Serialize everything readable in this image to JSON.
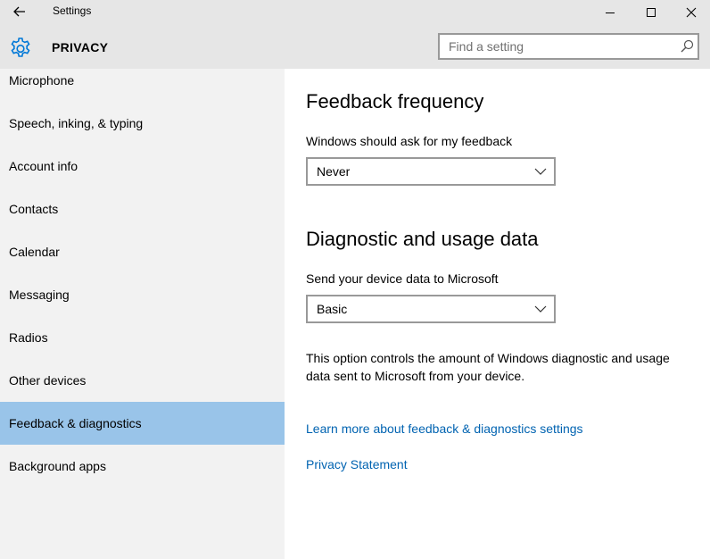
{
  "window": {
    "title": "Settings",
    "controls": [
      "minimize-icon",
      "maximize-icon",
      "close-icon"
    ]
  },
  "header": {
    "title": "PRIVACY",
    "icon": "gear-icon",
    "search": {
      "placeholder": "Find a setting",
      "value": "",
      "icon": "search-icon"
    }
  },
  "sidebar": {
    "items": [
      {
        "label": "Microphone",
        "selected": false
      },
      {
        "label": "Speech, inking, & typing",
        "selected": false
      },
      {
        "label": "Account info",
        "selected": false
      },
      {
        "label": "Contacts",
        "selected": false
      },
      {
        "label": "Calendar",
        "selected": false
      },
      {
        "label": "Messaging",
        "selected": false
      },
      {
        "label": "Radios",
        "selected": false
      },
      {
        "label": "Other devices",
        "selected": false
      },
      {
        "label": "Feedback & diagnostics",
        "selected": true
      },
      {
        "label": "Background apps",
        "selected": false
      }
    ]
  },
  "main": {
    "feedback": {
      "heading": "Feedback frequency",
      "label": "Windows should ask for my feedback",
      "value": "Never"
    },
    "diagnostic": {
      "heading": "Diagnostic and usage data",
      "label": "Send your device data to Microsoft",
      "value": "Basic",
      "description": "This option controls the amount of Windows diagnostic and usage data sent to Microsoft from your device."
    },
    "links": {
      "learn_more": "Learn more about feedback & diagnostics settings",
      "privacy": "Privacy Statement"
    }
  },
  "colors": {
    "selected_bg": "#99c4e9",
    "link": "#0063b1",
    "accent": "#0078d7",
    "titlebar_bg": "#e6e6e6",
    "sidebar_bg": "#f2f2f2"
  }
}
